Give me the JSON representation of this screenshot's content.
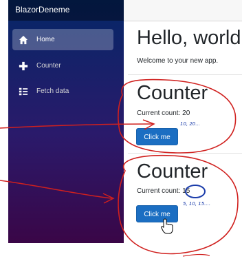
{
  "app": {
    "brand": "BlazorDeneme"
  },
  "nav": {
    "items": [
      {
        "label": "Home",
        "icon": "home-icon"
      },
      {
        "label": "Counter",
        "icon": "plus-icon"
      },
      {
        "label": "Fetch data",
        "icon": "list-icon"
      }
    ]
  },
  "main": {
    "title": "Hello, world!",
    "welcome": "Welcome to your new app.",
    "counters": [
      {
        "title": "Counter",
        "count_label": "Current count: 20",
        "button": "Click me"
      },
      {
        "title": "Counter",
        "count_label": "Current count:",
        "count_value": "15",
        "button": "Click me"
      }
    ]
  },
  "annotations": {
    "note1": "10, 20...",
    "note2": "5, 10, 15...."
  },
  "colors": {
    "accent": "#1b6ec2",
    "ink_red": "#d0201e",
    "ink_blue": "#1a3caa"
  }
}
